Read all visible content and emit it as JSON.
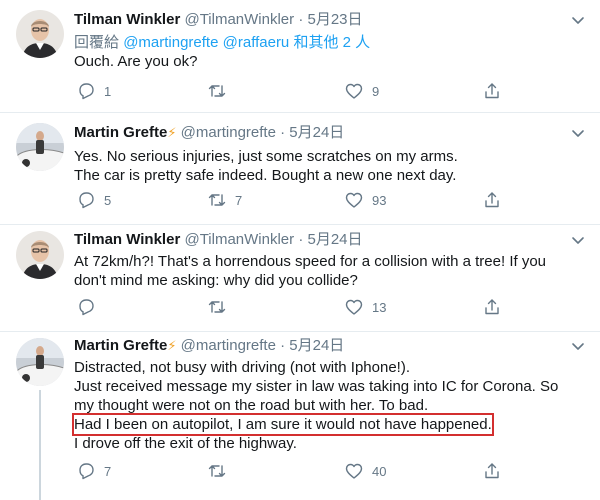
{
  "tweets": [
    {
      "name": "Tilman Winkler",
      "badge": "",
      "handle": "@TilmanWinkler",
      "dot": "·",
      "date": "5月23日",
      "reply_prefix": "回覆給",
      "reply_mention_1": "@martingrefte",
      "reply_mention_2": "@raffaeru",
      "reply_suffix": "和其他 2 人",
      "lines": [
        "Ouch. Are you ok?"
      ],
      "replies": "1",
      "retweets": "",
      "likes": "9"
    },
    {
      "name": "Martin Grefte",
      "badge": "⚡",
      "handle": "@martingrefte",
      "dot": "·",
      "date": "5月24日",
      "lines": [
        "Yes. No serious injuries, just some scratches on my arms.",
        "The car is pretty safe indeed. Bought a new one next day."
      ],
      "replies": "5",
      "retweets": "7",
      "likes": "93"
    },
    {
      "name": "Tilman Winkler",
      "badge": "",
      "handle": "@TilmanWinkler",
      "dot": "·",
      "date": "5月24日",
      "lines": [
        "At 72km/h?! That's a horrendous speed for a collision with a tree! If you",
        "don't mind me asking: why did you collide?"
      ],
      "replies": "",
      "retweets": "",
      "likes": "13"
    },
    {
      "name": "Martin Grefte",
      "badge": "⚡",
      "handle": "@martingrefte",
      "dot": "·",
      "date": "5月24日",
      "lines": [
        "Distracted, not busy with driving (not with Iphone!).",
        "Just received message my sister in law was taking into IC for Corona. So",
        "my thought were not on the road but with her. To bad.",
        "Had I been on autopilot, I am sure it would not have happened.",
        "I drove off the exit of the highway."
      ],
      "replies": "7",
      "retweets": "",
      "likes": "40"
    }
  ],
  "colors": {
    "text": "#14171a",
    "secondary": "#657786",
    "link": "#1da1f2",
    "highlight_box": "#d32f2f"
  },
  "icons": [
    "reply-icon",
    "retweet-icon",
    "like-icon",
    "share-icon",
    "chevron-down-icon"
  ]
}
